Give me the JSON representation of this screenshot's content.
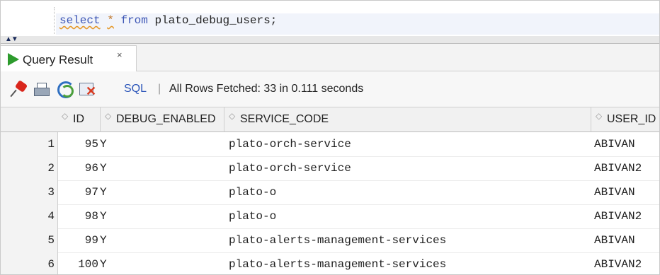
{
  "editor": {
    "sql_parts": [
      "select",
      "*",
      "from",
      "plato_debug_users;"
    ]
  },
  "result_tab": {
    "label": "Query Result",
    "close": "×"
  },
  "toolbar": {
    "sql_label": "SQL",
    "separator": "|",
    "status": "All Rows Fetched: 33 in 0.111 seconds"
  },
  "table": {
    "columns": [
      "ID",
      "DEBUG_ENABLED",
      "SERVICE_CODE",
      "USER_ID"
    ],
    "rows": [
      {
        "n": "1",
        "id": "95",
        "debug": "Y",
        "service": "plato-orch-service",
        "user": "ABIVAN"
      },
      {
        "n": "2",
        "id": "96",
        "debug": "Y",
        "service": "plato-orch-service",
        "user": "ABIVAN2"
      },
      {
        "n": "3",
        "id": "97",
        "debug": "Y",
        "service": "plato-o",
        "user": "ABIVAN"
      },
      {
        "n": "4",
        "id": "98",
        "debug": "Y",
        "service": "plato-o",
        "user": "ABIVAN2"
      },
      {
        "n": "5",
        "id": "99",
        "debug": "Y",
        "service": "plato-alerts-management-services",
        "user": "ABIVAN"
      },
      {
        "n": "6",
        "id": "100",
        "debug": "Y",
        "service": "plato-alerts-management-services",
        "user": "ABIVAN2"
      }
    ]
  }
}
